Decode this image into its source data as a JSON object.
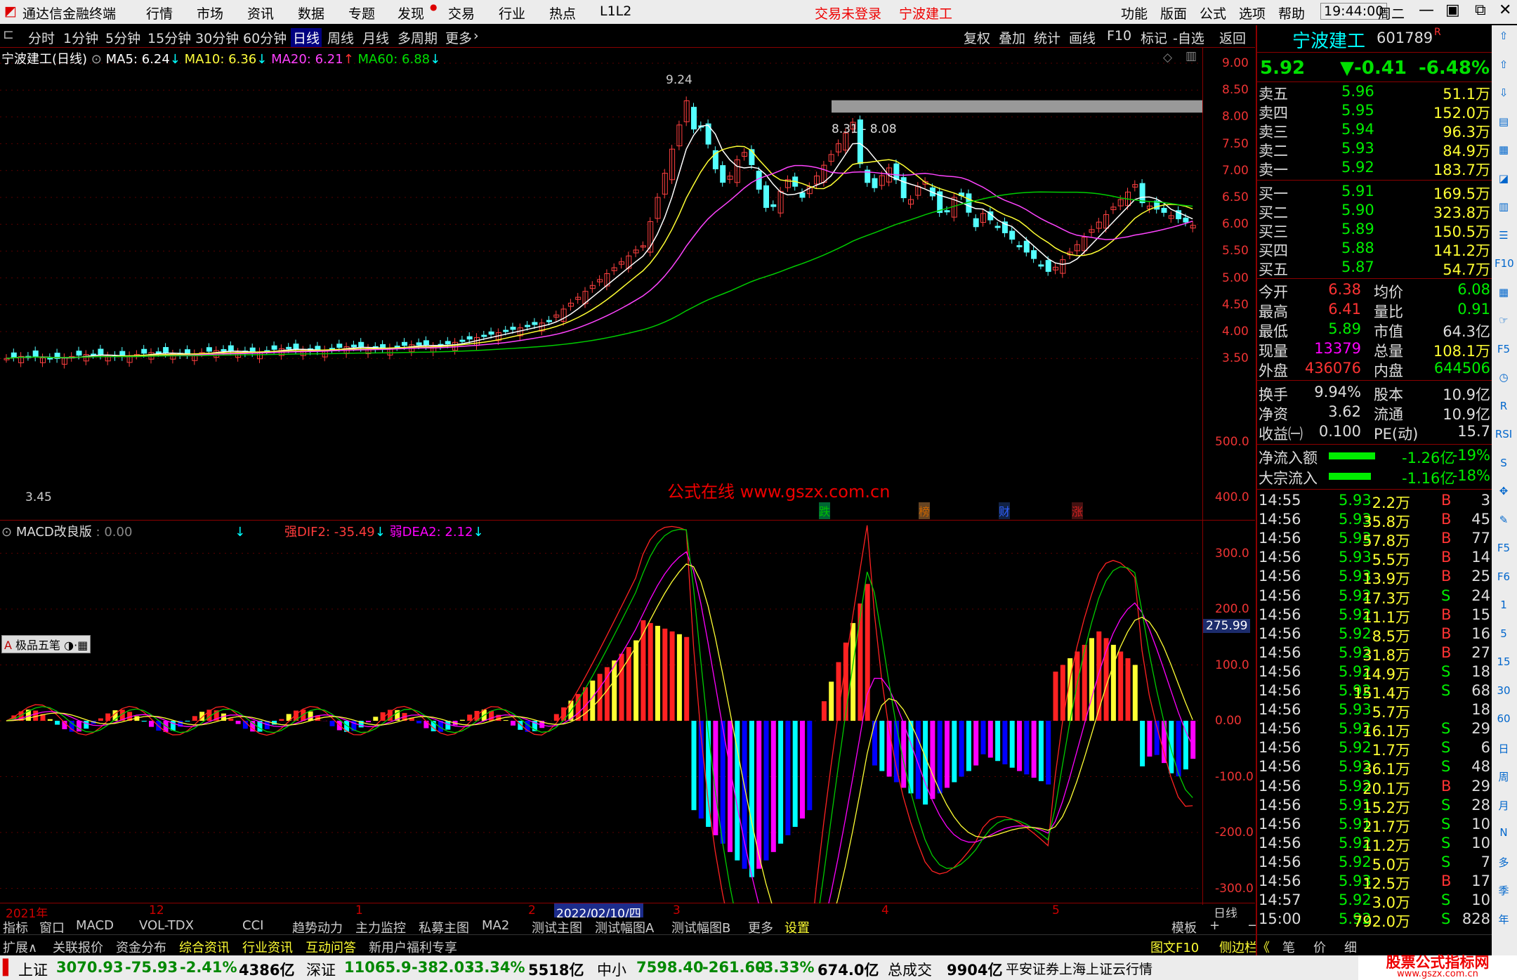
{
  "app": {
    "title": "通达信金融终端",
    "menus": [
      "行情",
      "市场",
      "资讯",
      "数据",
      "专题",
      "发现",
      "交易",
      "行业",
      "热点",
      "L1L2"
    ],
    "notice": "交易未登录",
    "stock_name_top": "宁波建工",
    "right_menus": [
      "功能",
      "版面",
      "公式",
      "选项",
      "帮助"
    ],
    "clock": "19:44:00",
    "weekday": "周二"
  },
  "periods": [
    "分时",
    "1分钟",
    "5分钟",
    "15分钟",
    "30分钟",
    "60分钟",
    "日线",
    "周线",
    "月线",
    "多周期",
    "更多"
  ],
  "active_period": "日线",
  "right_buttons": [
    "复权",
    "叠加",
    "统计",
    "画线",
    "F10",
    "标记",
    "-自选",
    "返回"
  ],
  "main": {
    "title": "宁波建工(日线)",
    "ma": [
      {
        "label": "MA5: 6.24",
        "color": "#ffffff"
      },
      {
        "label": "MA10: 6.36",
        "color": "#ffff3c"
      },
      {
        "label": "MA20: 6.21",
        "color": "#ff40ff"
      },
      {
        "label": "MA60: 6.88",
        "color": "#00e000"
      }
    ],
    "y_ticks": [
      "9.00",
      "8.50",
      "8.00",
      "7.50",
      "7.00",
      "6.50",
      "6.00",
      "5.50",
      "5.00",
      "4.50",
      "4.00",
      "3.50"
    ],
    "high_label": "9.24",
    "low_label": "3.45",
    "zone_label": "8.31 - 8.08",
    "watermark": "公式在线  www.gszx.com.cn",
    "event_tags": [
      {
        "text": "跌",
        "color": "#00c000"
      },
      {
        "text": "榜",
        "color": "#c86400"
      },
      {
        "text": "财",
        "color": "#3060ff"
      },
      {
        "text": "涨",
        "color": "#d02020"
      }
    ]
  },
  "macd": {
    "title": "MACD改良版",
    "value": ": 0.00",
    "dif": "强DIF2: -35.49",
    "dea": "弱DEA2: 2.12",
    "y_ticks": [
      "500.0",
      "400.0",
      "300.0",
      "200.0",
      "100.0",
      "0.00",
      "-100.0",
      "-200.0",
      "-300.0"
    ],
    "cursor_value": "275.99",
    "toolbox": "极品五笔"
  },
  "xaxis": [
    "2021年",
    "12",
    "1",
    "2",
    "2022/02/10/四",
    "3",
    "4",
    "5"
  ],
  "xaxis_right": "日线",
  "bottom_tabs": [
    "指标",
    "窗口",
    "MACD",
    "VOL-TDX",
    "CCI",
    "趋势动力",
    "主力监控",
    "私募主图",
    "MA2",
    "测试主图",
    "测试幅图A",
    "测试幅图B",
    "更多",
    "设置"
  ],
  "bottom_right": [
    "模板",
    "+",
    "−"
  ],
  "bottom_tabs2": [
    "扩展∧",
    "关联报价",
    "资金分布",
    "综合资讯",
    "行业资讯",
    "互动问答",
    "新用户福利专享"
  ],
  "bottom_tabs2_right": [
    "图文F10",
    "侧边栏《",
    "笔",
    "价",
    "细"
  ],
  "quote": {
    "name": "宁波建工",
    "code": "601789",
    "flag": "R",
    "price": "5.92",
    "change": "▼-0.41",
    "pct": "-6.48%",
    "asks": [
      {
        "label": "卖五",
        "price": "5.96",
        "vol": "51.1万"
      },
      {
        "label": "卖四",
        "price": "5.95",
        "vol": "152.0万"
      },
      {
        "label": "卖三",
        "price": "5.94",
        "vol": "96.3万"
      },
      {
        "label": "卖二",
        "price": "5.93",
        "vol": "84.9万"
      },
      {
        "label": "卖一",
        "price": "5.92",
        "vol": "183.7万"
      }
    ],
    "bids": [
      {
        "label": "买一",
        "price": "5.91",
        "vol": "169.5万"
      },
      {
        "label": "买二",
        "price": "5.90",
        "vol": "323.8万"
      },
      {
        "label": "买三",
        "price": "5.89",
        "vol": "150.5万"
      },
      {
        "label": "买四",
        "price": "5.88",
        "vol": "141.2万"
      },
      {
        "label": "买五",
        "price": "5.87",
        "vol": "54.7万"
      }
    ],
    "stats": [
      [
        "今开",
        "6.38",
        "均价",
        "6.08"
      ],
      [
        "最高",
        "6.41",
        "量比",
        "0.91"
      ],
      [
        "最低",
        "5.89",
        "市值",
        "64.3亿"
      ],
      [
        "现量",
        "13379",
        "总量",
        "108.1万"
      ],
      [
        "外盘",
        "436076",
        "内盘",
        "644506"
      ],
      [
        "换手",
        "9.94%",
        "股本",
        "10.9亿"
      ],
      [
        "净资",
        "3.62",
        "流通",
        "10.9亿"
      ],
      [
        "收益㈠",
        "0.100",
        "PE(动)",
        "15.7"
      ]
    ],
    "flows": [
      {
        "label": "净流入额",
        "value": "-1.26亿",
        "pct": "-19%"
      },
      {
        "label": "大宗流入",
        "value": "-1.16亿",
        "pct": "-18%"
      }
    ],
    "ticks": [
      [
        "14:55",
        "5.93",
        "2.2万",
        "B",
        "3"
      ],
      [
        "14:56",
        "5.93",
        "35.8万",
        "B",
        "45"
      ],
      [
        "14:56",
        "5.93",
        "57.8万",
        "B",
        "77"
      ],
      [
        "14:56",
        "5.93",
        "5.5万",
        "B",
        "14"
      ],
      [
        "14:56",
        "5.93",
        "13.9万",
        "B",
        "25"
      ],
      [
        "14:56",
        "5.92",
        "17.3万",
        "S",
        "24"
      ],
      [
        "14:56",
        "5.92",
        "11.1万",
        "B",
        "15"
      ],
      [
        "14:56",
        "5.92",
        "8.5万",
        "B",
        "16"
      ],
      [
        "14:56",
        "5.92",
        "31.8万",
        "B",
        "27"
      ],
      [
        "14:56",
        "5.92",
        "14.9万",
        "S",
        "18"
      ],
      [
        "14:56",
        "5.92",
        "151.4万",
        "S",
        "68"
      ],
      [
        "14:56",
        "5.93",
        "5.7万",
        "",
        "18"
      ],
      [
        "14:56",
        "5.92",
        "16.1万",
        "S",
        "29"
      ],
      [
        "14:56",
        "5.92",
        "1.7万",
        "S",
        "6"
      ],
      [
        "14:56",
        "5.92",
        "36.1万",
        "S",
        "48"
      ],
      [
        "14:56",
        "5.92",
        "20.1万",
        "B",
        "29"
      ],
      [
        "14:56",
        "5.91",
        "15.2万",
        "S",
        "28"
      ],
      [
        "14:56",
        "5.91",
        "21.7万",
        "S",
        "10"
      ],
      [
        "14:56",
        "5.92",
        "11.2万",
        "S",
        "10"
      ],
      [
        "14:56",
        "5.92",
        "5.0万",
        "S",
        "7"
      ],
      [
        "14:56",
        "5.93",
        "12.5万",
        "B",
        "17"
      ],
      [
        "14:57",
        "5.92",
        "3.0万",
        "S",
        "10"
      ],
      [
        "15:00",
        "5.92",
        "792.0万",
        "S",
        "828"
      ]
    ]
  },
  "status": [
    {
      "name": "上证",
      "val": "3070.93",
      "chg": "-75.93",
      "pct": "-2.41%",
      "amt": "4386亿"
    },
    {
      "name": "深证",
      "val": "11065.9",
      "chg": "-382.03",
      "pct": "-3.34%",
      "amt": "5518亿"
    },
    {
      "name": "中小",
      "val": "7598.40",
      "chg": "-261.60",
      "pct": "-3.33%",
      "amt": "674.0亿"
    }
  ],
  "status_total_label": "总成交",
  "status_total": "9904亿",
  "broker": "平安证券上海上证云行情",
  "logo_text": "股票公式指标网",
  "logo_url": "www.gszx.com.cn",
  "vicons": [
    "arrow-up",
    "arrow-up",
    "arrow-down",
    "doc",
    "table",
    "chart",
    "bars",
    "list",
    "F10",
    "grid",
    "hand",
    "F5",
    "clock",
    "R",
    "RSI",
    "S",
    "cross",
    "pen",
    "F5",
    "F6",
    "1",
    "5",
    "15",
    "30",
    "60",
    "日",
    "周",
    "月",
    "N",
    "多",
    "季",
    "年"
  ]
}
